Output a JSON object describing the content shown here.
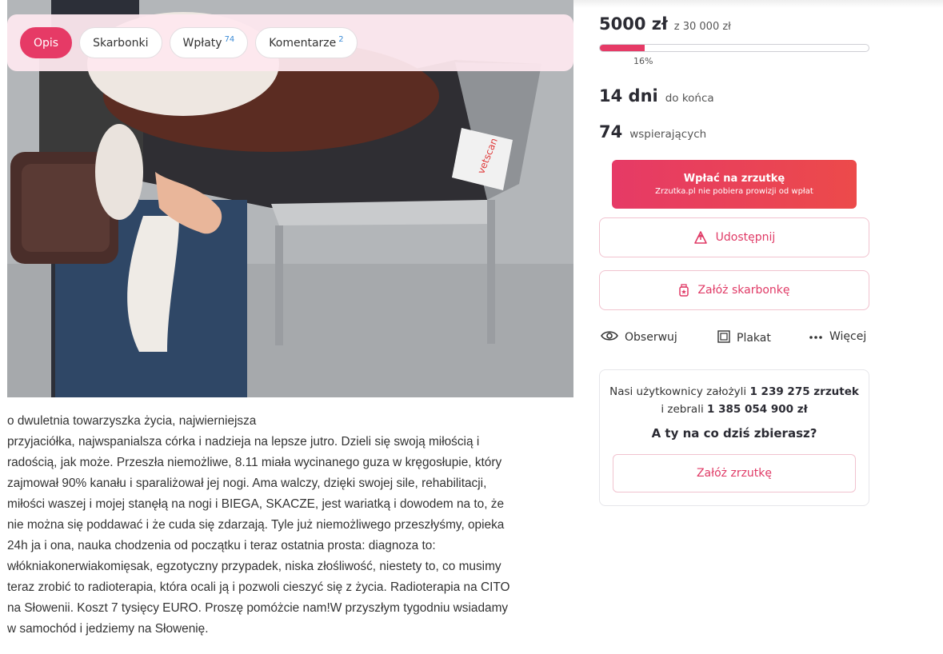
{
  "tabs": [
    {
      "label": "Opis",
      "count": ""
    },
    {
      "label": "Skarbonki",
      "count": ""
    },
    {
      "label": "Wpłaty",
      "count": "74"
    },
    {
      "label": "Komentarze",
      "count": "2"
    }
  ],
  "photo": {
    "label_text": "vetscan"
  },
  "description": {
    "lines": [
      "o dwuletnia towarzyszka życia, najwierniejsza",
      "przyjaciółka, najwspanialsza córka i nadzieja na lepsze jutro. Dzieli się swoją miłością i",
      "radością, jak może. Przeszła niemożliwe, 8.11 miała wycinanego guza w kręgosłupie, który",
      "zajmował 90% kanału i sparaliżował jej nogi. Ama walczy, dzięki swojej sile, rehabilitacji,",
      "miłości waszej i mojej stanęłą na nogi i BIEGA, SKACZE, jest wariatką i dowodem na to, że",
      "nie można się poddawać i że cuda się zdarzają. Tyle już niemożliwego przeszłyśmy, opieka",
      "24h ja i ona, nauka chodzenia od początku i teraz ostatnia prosta: diagnoza to:",
      "włókniakonerwiakomięsak, egzotyczny przypadek, niska złośliwość, niestety to, co musimy",
      "teraz zrobić to radioterapia, która ocali ją i pozwoli cieszyć się z życia. Radioterapia na CITO",
      "na Słowenii. Koszt 7 tysięcy EURO. Proszę pomóżcie nam!W przyszłym tygodniu wsiadamy",
      "w samochód i jedziemy na Słowenię."
    ]
  },
  "fundraiser": {
    "raised": "5000 zł",
    "goal": "z 30 000 zł",
    "progress_label": "16%",
    "progress_fraction": 0.1667,
    "days_value": "14 dni",
    "days_label": "do końca",
    "supporters_value": "74",
    "supporters_label": "wspierających"
  },
  "buttons": {
    "pay_title": "Wpłać na zrzutkę",
    "pay_sub": "Zrzutka.pl nie pobiera prowizji od wpłat",
    "share": "Udostępnij",
    "piggybank": "Załóż skarbonkę",
    "follow": "Obserwuj",
    "poster": "Plakat",
    "more": "Więcej"
  },
  "promo": {
    "line1_text": "Nasi użytkownicy założyli",
    "line1_bold": "1 239 275 zrzutek",
    "line2_text": "i zebrali",
    "line2_bold": "1 385 054 900 zł",
    "question": "A ty na co dziś zbierasz?",
    "create": "Załóż zrzutkę"
  },
  "colors": {
    "accent": "#e63a66",
    "accent_end": "#ec4a4a"
  }
}
